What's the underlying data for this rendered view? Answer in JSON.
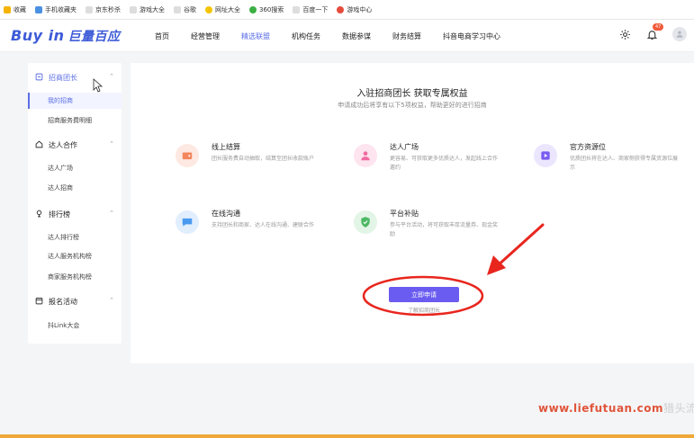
{
  "bookmarks": [
    "收藏",
    "手机收藏夹",
    "京东秒杀",
    "游戏大全",
    "谷歌",
    "网址大全",
    "360搜索",
    "百度一下",
    "游戏中心"
  ],
  "logo": {
    "main": "Buy in",
    "sub": "巨量百应"
  },
  "nav": [
    "首页",
    "经营管理",
    "精选联盟",
    "机构任务",
    "数据参谋",
    "财务结算",
    "抖音电商学习中心"
  ],
  "nav_active_index": 2,
  "notif_count": "47",
  "sidebar": {
    "sections": [
      {
        "label": "招商团长",
        "items": [
          "我的招商",
          "招商服务费明细"
        ]
      },
      {
        "label": "达人合作",
        "items": [
          "达人广场",
          "达人招商"
        ]
      },
      {
        "label": "排行榜",
        "items": [
          "达人排行榜",
          "达人服务机构榜",
          "商家服务机构榜"
        ]
      },
      {
        "label": "报名活动",
        "items": [
          "抖Link大会"
        ]
      }
    ]
  },
  "main": {
    "title": "入驻招商团长 获取专属权益",
    "subtitle": "申请成功后将享有以下5项权益，帮助更好的进行招商",
    "features": [
      {
        "title": "线上结算",
        "desc": "团长服务费自动抽取，结算至团长收款账户"
      },
      {
        "title": "达人广场",
        "desc": "更容易、可获取更多优质达人，发起线上合作邀约"
      },
      {
        "title": "官方资源位",
        "desc": "优质团长将在达人、商家侧获得专属资源位展示"
      },
      {
        "title": "在线沟通",
        "desc": "支持团长和商家、达人在线沟通、建联合作"
      },
      {
        "title": "平台补贴",
        "desc": "参与平台活动，将可获取丰厚流量券、现金奖励"
      }
    ],
    "apply_label": "立即申请",
    "more_label": "了解招商团长"
  },
  "watermark": {
    "domain": "www.liefutuan.com",
    "rest": "猎头流量池"
  },
  "colors": {
    "accent": "#5b6ee6",
    "button": "#6a5cf0",
    "annotation": "#e8261e"
  }
}
